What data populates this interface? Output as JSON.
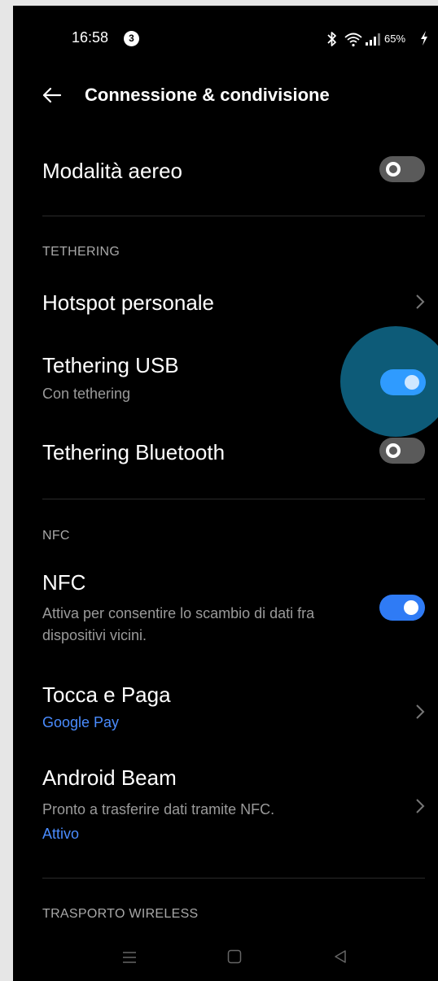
{
  "status_bar": {
    "time": "16:58",
    "notification_count": "3",
    "battery": "65%",
    "icons": [
      "bluetooth-icon",
      "wifi-icon",
      "signal-icon",
      "charging-icon"
    ]
  },
  "header": {
    "title": "Connessione & condivisione",
    "back_icon": "arrow-left-icon"
  },
  "airplane": {
    "title": "Modalità aereo",
    "enabled": false
  },
  "sections": {
    "tethering": "TETHERING",
    "nfc": "NFC",
    "wireless": "TRASPORTO WIRELESS"
  },
  "tethering": {
    "hotspot": {
      "title": "Hotspot personale"
    },
    "usb": {
      "title": "Tethering USB",
      "subtitle": "Con tethering",
      "enabled": true
    },
    "bluetooth": {
      "title": "Tethering Bluetooth",
      "enabled": false
    }
  },
  "nfc": {
    "nfc": {
      "title": "NFC",
      "subtitle_line1": "Attiva per consentire lo scambio di dati fra",
      "subtitle_line2": "dispositivi vicini.",
      "enabled": true
    },
    "tap_pay": {
      "title": "Tocca e Paga",
      "value": "Google Pay"
    },
    "beam": {
      "title": "Android Beam",
      "subtitle": "Pronto a trasferire dati tramite NFC.",
      "status": "Attivo"
    }
  },
  "navigation_bar": {
    "icons": [
      "menu-icon",
      "home-icon",
      "back-triangle-icon"
    ]
  },
  "colors": {
    "background": "#000000",
    "accent": "#2f7bf5",
    "link": "#4a8cff",
    "touch_indicator": "#0d5b78"
  }
}
